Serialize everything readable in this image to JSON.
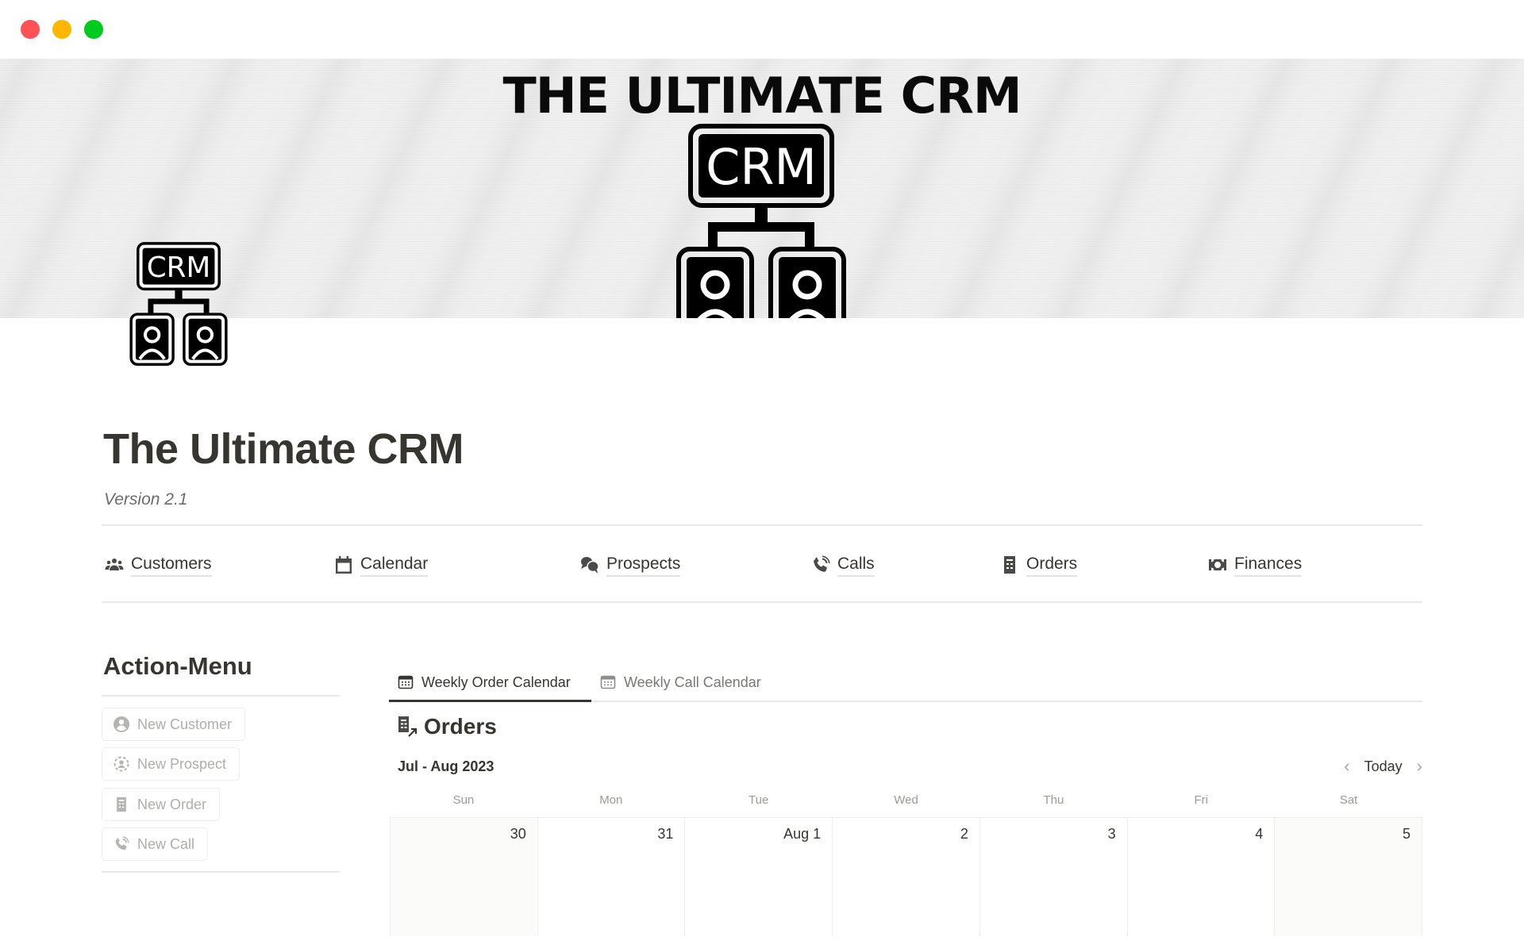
{
  "window": {
    "controls": [
      "close",
      "minimize",
      "maximize"
    ],
    "colors": {
      "close": "#ff5257",
      "minimize": "#ffb600",
      "maximize": "#00c91f"
    }
  },
  "cover": {
    "title": "THE ULTIMATE CRM",
    "logo_text": "CRM",
    "logo_icon": "crm-network-icon"
  },
  "page": {
    "icon": "crm-network-icon",
    "icon_text": "CRM",
    "title": "The Ultimate CRM",
    "subtitle": "Version 2.1"
  },
  "nav": [
    {
      "label": "Customers",
      "icon": "people-icon"
    },
    {
      "label": "Calendar",
      "icon": "calendar-icon"
    },
    {
      "label": "Prospects",
      "icon": "chat-bubbles-icon"
    },
    {
      "label": "Calls",
      "icon": "phone-icon"
    },
    {
      "label": "Orders",
      "icon": "receipt-icon"
    },
    {
      "label": "Finances",
      "icon": "money-icon"
    }
  ],
  "action_menu": {
    "title": "Action-Menu",
    "buttons": [
      {
        "label": "New Customer",
        "icon": "user-circle-icon"
      },
      {
        "label": "New Prospect",
        "icon": "user-dashed-circle-icon"
      },
      {
        "label": "New Order",
        "icon": "receipt-icon"
      },
      {
        "label": "New Call",
        "icon": "phone-icon"
      }
    ]
  },
  "views": {
    "tabs": [
      {
        "label": "Weekly Order Calendar",
        "icon": "calendar-view-icon",
        "active": true
      },
      {
        "label": "Weekly Call Calendar",
        "icon": "calendar-view-icon",
        "active": false
      }
    ],
    "database_title": "Orders",
    "database_icon": "receipt-link-icon",
    "month_label": "Jul - Aug 2023",
    "today_label": "Today",
    "prev_icon": "chevron-left-icon",
    "next_icon": "chevron-right-icon",
    "day_headers": [
      "Sun",
      "Mon",
      "Tue",
      "Wed",
      "Thu",
      "Fri",
      "Sat"
    ],
    "days": [
      {
        "label": "30",
        "weekend": true
      },
      {
        "label": "31",
        "weekend": false
      },
      {
        "label": "Aug 1",
        "weekend": false
      },
      {
        "label": "2",
        "weekend": false
      },
      {
        "label": "3",
        "weekend": false
      },
      {
        "label": "4",
        "weekend": false
      },
      {
        "label": "5",
        "weekend": true
      }
    ]
  }
}
